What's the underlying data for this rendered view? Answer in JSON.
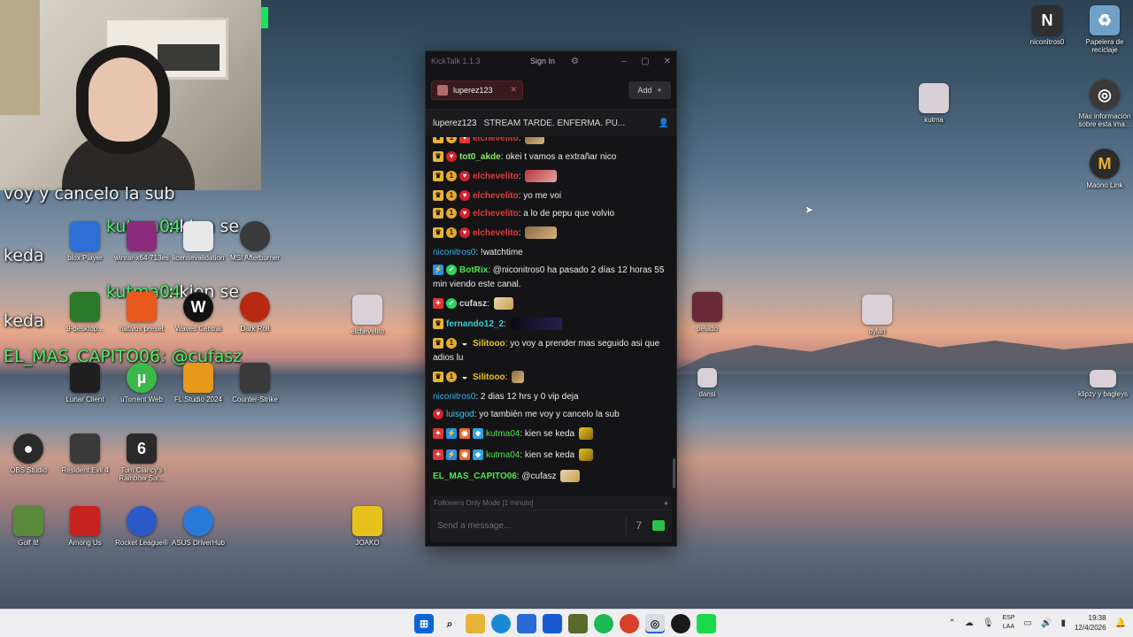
{
  "webcam_overlay": {
    "line1": "voy y cancelo la sub",
    "line2_name": "kutma04",
    "line2_text": ": kien se",
    "line2b": "keda",
    "line3_name": "kutma04",
    "line3_text": ": kien se",
    "line3b": "keda",
    "line4": "EL_MAS_CAPITO06: @cufasz"
  },
  "desktop_icons": [
    {
      "label": "niconitros0",
      "glyph": "N",
      "color": "#2f2f2f"
    },
    {
      "label": "Papelera de reciclaje",
      "glyph": "♻",
      "color": "#6fa0c7"
    },
    {
      "label": "kutma",
      "glyph": "",
      "color": "#d9cfd6"
    },
    {
      "label": "Más información sobre esta ima...",
      "glyph": "◎",
      "color": "#3a3a3a"
    },
    {
      "label": "Maono Link",
      "glyph": "M",
      "color": "#2b2b2b"
    },
    {
      "label": "blox Player",
      "glyph": "",
      "color": "#2e6fd6"
    },
    {
      "label": "winrar-x64-713es",
      "glyph": "",
      "color": "#8a2a7a"
    },
    {
      "label": "licensevalidation",
      "glyph": "",
      "color": "#e8e8e8"
    },
    {
      "label": "MSI Afterburner",
      "glyph": "",
      "color": "#3a3a3a"
    },
    {
      "label": "9-desktop...",
      "glyph": "",
      "color": "#2a7a2a"
    },
    {
      "label": "nativos preset",
      "glyph": "",
      "color": "#e8571c"
    },
    {
      "label": "Waves Central",
      "glyph": "W",
      "color": "#111111"
    },
    {
      "label": "Dark Roll",
      "glyph": "",
      "color": "#b82a10"
    },
    {
      "label": "elchevelito",
      "glyph": "",
      "color": "#d9d0d8"
    },
    {
      "label": "pelado",
      "glyph": "",
      "color": "#6a2a3a"
    },
    {
      "label": "dylan",
      "glyph": "",
      "color": "#d9d0d8"
    },
    {
      "label": "Lunar Client",
      "glyph": "",
      "color": "#1f1f1f"
    },
    {
      "label": "uTorrent Web",
      "glyph": "µ",
      "color": "#3ab94a"
    },
    {
      "label": "FL Studio 2024",
      "glyph": "",
      "color": "#e89a1c"
    },
    {
      "label": "Counter-Strike",
      "glyph": "",
      "color": "#3a3a3a"
    },
    {
      "label": "dansi",
      "glyph": "",
      "color": "#d9d0d8"
    },
    {
      "label": "klipzy y bagleys",
      "glyph": "",
      "color": "#d9d0d8"
    },
    {
      "label": "OBS Studio",
      "glyph": "●",
      "color": "#2a2a2a"
    },
    {
      "label": "Resident Evil 4",
      "glyph": "",
      "color": "#3a3a3a"
    },
    {
      "label": "Tom Clancy's Rainbow Six...",
      "glyph": "6",
      "color": "#2a2a2a"
    },
    {
      "label": "Golf It!",
      "glyph": "",
      "color": "#5a8a3a"
    },
    {
      "label": "Among Us",
      "glyph": "",
      "color": "#c8221e"
    },
    {
      "label": "Rocket League®",
      "glyph": "",
      "color": "#2a5ac8"
    },
    {
      "label": "ASUS DriverHub",
      "glyph": "",
      "color": "#2a7ad8"
    },
    {
      "label": "JOAKO",
      "glyph": "",
      "color": "#e8c21c"
    }
  ],
  "kicktalk": {
    "app_title": "KickTalk 1.1.3",
    "sign_in": "Sign In",
    "tab_label": "luperez123",
    "add_label": "Add",
    "channel": "luperez123",
    "stream_title": "STREAM TARDE. ENFERMA. PU...",
    "messages": [
      {
        "user": "elchevelito",
        "text": "",
        "color": "#e03a3a"
      },
      {
        "user": "tot0_akde",
        "text": "okei t vamos a extrañar nico",
        "color": "#8ee86a"
      },
      {
        "user": "elchevelito",
        "text": "",
        "color": "#e03a3a"
      },
      {
        "user": "elchevelito",
        "text": "yo me voi",
        "color": "#e03a3a"
      },
      {
        "user": "elchevelito",
        "text": "a lo de pepu que volvio",
        "color": "#e03a3a"
      },
      {
        "user": "elchevelito",
        "text": "",
        "color": "#e03a3a"
      },
      {
        "user": "niconitros0",
        "text": "!watchtime",
        "color": "#3ab0e8"
      },
      {
        "user": "BotRix",
        "text": "@niconitros0 ha pasado 2 días 12 horas 55 min viendo este canal.",
        "color": "#4ce84a"
      },
      {
        "user": "cufasz",
        "text": "",
        "color": "#d8d8d8"
      },
      {
        "user": "fernando12_2",
        "text": "",
        "color": "#3ad0d8"
      },
      {
        "user": "Silitooo",
        "text": "yo voy a prender mas seguido asi que adios lu",
        "color": "#e8c21c"
      },
      {
        "user": "Silitooo",
        "text": "",
        "color": "#e8c21c"
      },
      {
        "user": "niconitros0",
        "text": "2 dias 12 hrs y 0 vip deja",
        "color": "#3ab0e8"
      },
      {
        "user": "luisgod",
        "text": "yo también me voy y cancelo la sub",
        "color": "#3ad0e8"
      },
      {
        "user": "kutma04",
        "text": "kien se keda",
        "color": "#4ce84a"
      },
      {
        "user": "kutma04",
        "text": "kien se keda",
        "color": "#4ce84a"
      },
      {
        "user": "EL_MAS_CAPITO06",
        "text": "@cufasz",
        "color": "#4ce84a"
      }
    ],
    "followers_mode": "Followers Only Mode [1 minute]",
    "input_placeholder": "Send a message..."
  },
  "taskbar": {
    "lang_top": "ESP",
    "lang_bottom": "LAA",
    "time": "19:38",
    "date": "12/4/2026"
  }
}
